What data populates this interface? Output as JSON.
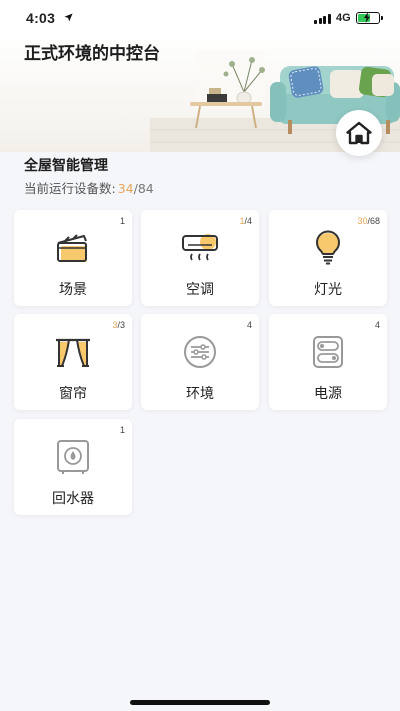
{
  "status_bar": {
    "time": "4:03",
    "network": "4G"
  },
  "hero": {
    "title": "正式环境的中控台"
  },
  "summary": {
    "title": "全屋智能管理",
    "running_label": "当前运行设备数:",
    "running_count": "34",
    "separator": "/",
    "total_count": "84"
  },
  "cards": [
    {
      "label": "场景",
      "count_total": "1"
    },
    {
      "label": "空调",
      "count_active": "1",
      "count_total": "/4"
    },
    {
      "label": "灯光",
      "count_active": "30",
      "count_total": "/68"
    },
    {
      "label": "窗帘",
      "count_active": "3",
      "count_total": "/3"
    },
    {
      "label": "环境",
      "count_total": "4"
    },
    {
      "label": "电源",
      "count_total": "4"
    },
    {
      "label": "回水器",
      "count_total": "1"
    }
  ],
  "colors": {
    "accent": "#e8a557",
    "icon_fill": "#f7c96c",
    "icon_stroke": "#333333"
  }
}
